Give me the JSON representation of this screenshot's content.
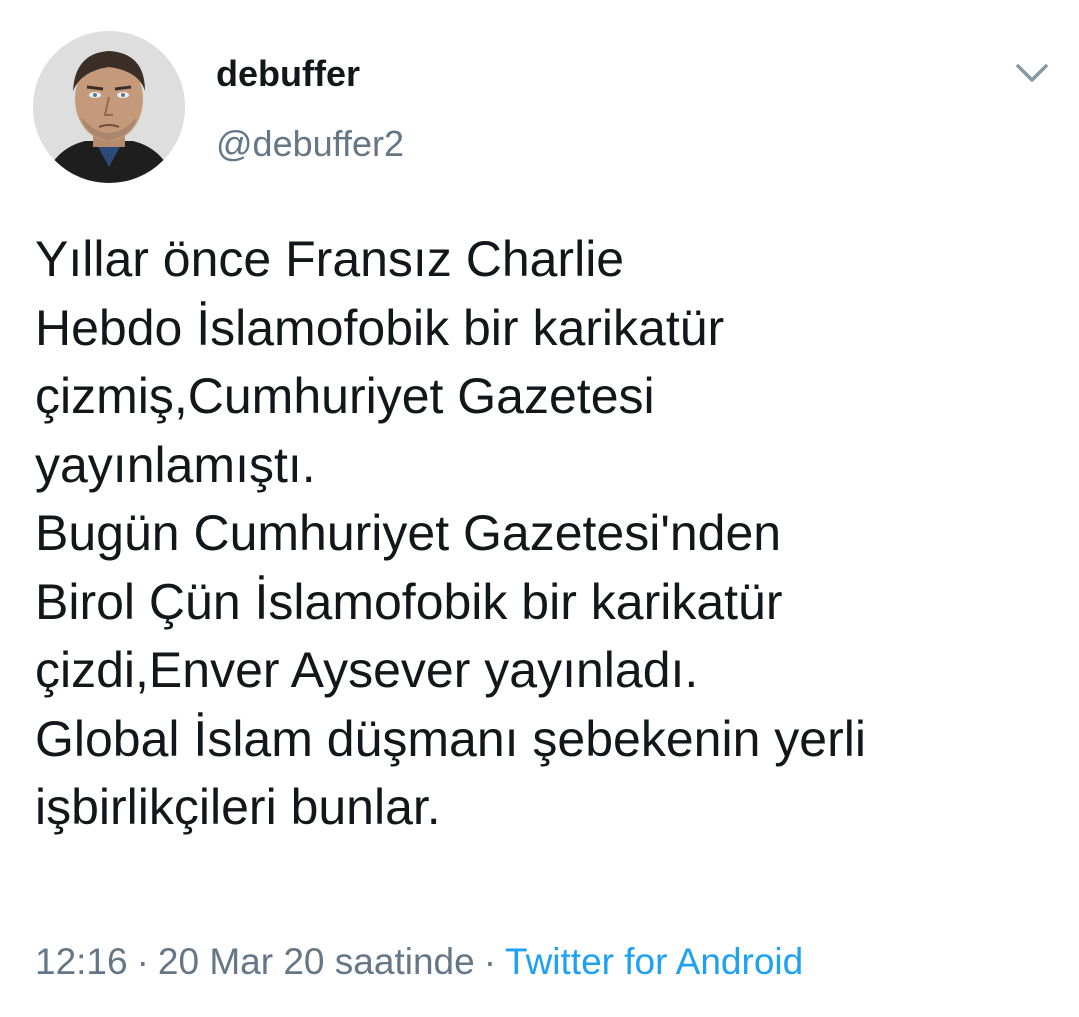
{
  "user": {
    "display_name": "debuffer",
    "handle": "@debuffer2",
    "avatar_icon": "profile-photo"
  },
  "header": {
    "menu_icon": "chevron-down-icon"
  },
  "tweet": {
    "lines": [
      "Yıllar önce  Fransız Charlie",
      "Hebdo İslamofobik bir karikatür",
      "çizmiş,Cumhuriyet Gazetesi",
      "yayınlamıştı.",
      "Bugün Cumhuriyet Gazetesi'nden",
      "Birol Çün İslamofobik bir karikatür",
      "çizdi,Enver Aysever yayınladı.",
      "Global İslam düşmanı şebekenin yerli",
      "işbirlikçileri bunlar."
    ]
  },
  "meta": {
    "time": "12:16",
    "separator": "·",
    "date": "20 Mar 20 saatinde",
    "source": "Twitter for Android"
  },
  "colors": {
    "text": "#14171a",
    "secondary": "#657786",
    "link": "#1da1f2",
    "background": "#ffffff"
  }
}
